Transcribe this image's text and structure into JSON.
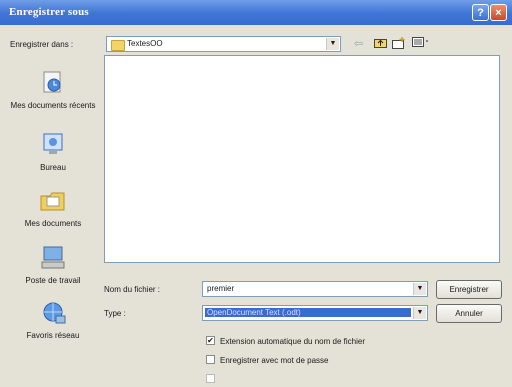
{
  "window": {
    "title": "Enregistrer sous"
  },
  "header": {
    "save_in_label": "Enregistrer dans :",
    "save_in_value": "TextesOO"
  },
  "toolbar": {
    "icons": [
      "back-icon",
      "up-folder-icon",
      "new-folder-icon",
      "view-menu-icon"
    ]
  },
  "places": [
    {
      "label": "Mes documents récents",
      "icon": "recent-documents-icon"
    },
    {
      "label": "Bureau",
      "icon": "desktop-icon"
    },
    {
      "label": "Mes documents",
      "icon": "my-documents-icon"
    },
    {
      "label": "Poste de travail",
      "icon": "my-computer-icon"
    },
    {
      "label": "Favoris réseau",
      "icon": "network-places-icon"
    }
  ],
  "form": {
    "filename_label": "Nom du fichier :",
    "filename_value": "premier",
    "type_label": "Type :",
    "type_value": "OpenDocument Text (.odt)"
  },
  "buttons": {
    "save": "Enregistrer",
    "cancel": "Annuler"
  },
  "options": [
    {
      "label": "Extension automatique du nom de fichier",
      "checked": true
    },
    {
      "label": "Enregistrer avec mot de passe",
      "checked": false
    }
  ],
  "colors": {
    "titlebar": "#3f74d6",
    "selection": "#3a6ccd"
  }
}
